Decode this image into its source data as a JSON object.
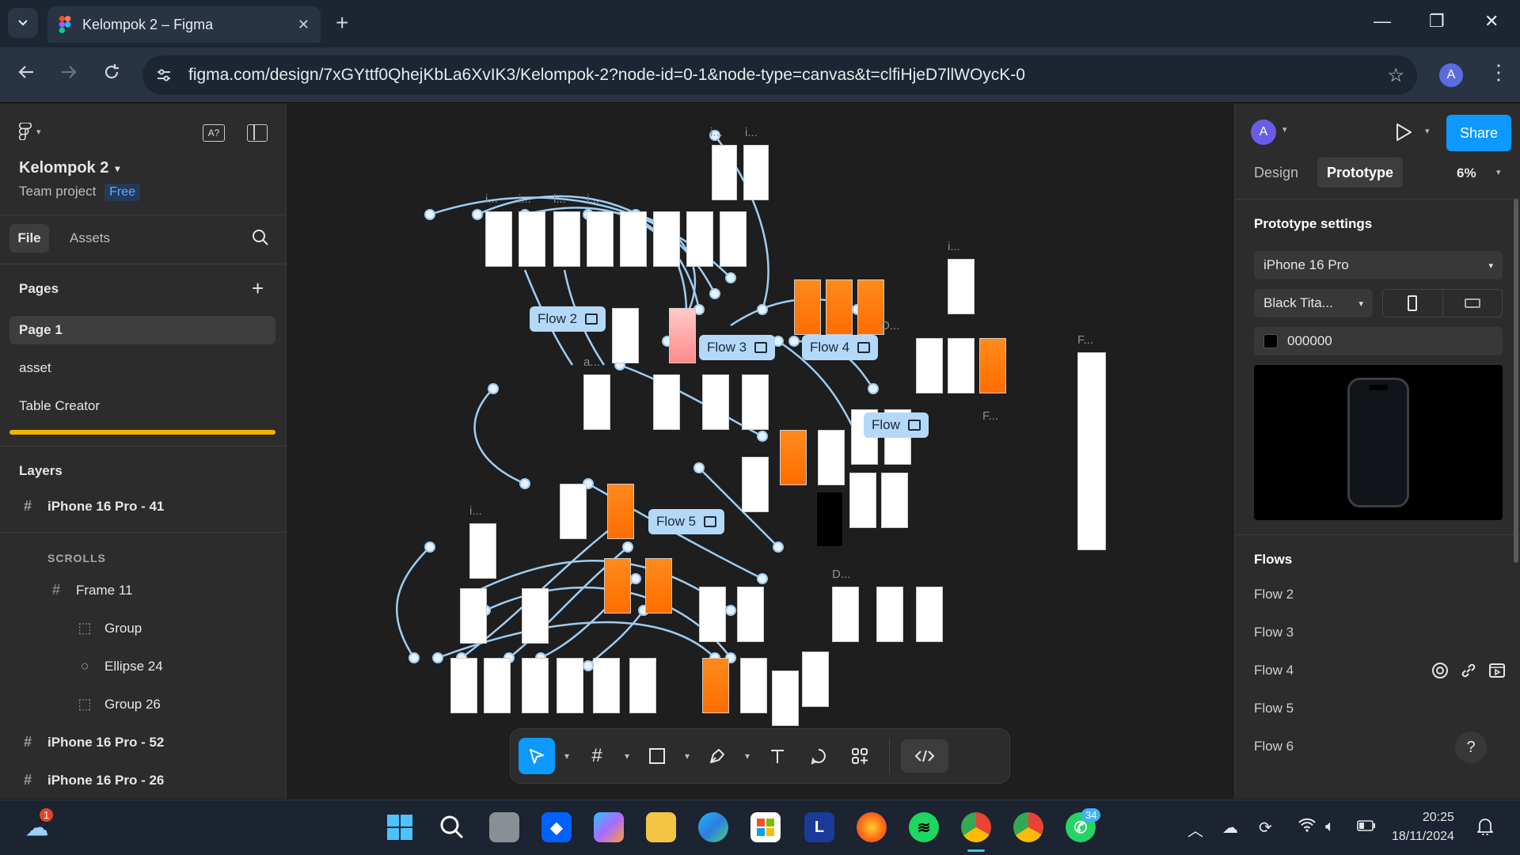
{
  "browser": {
    "tab_title": "Kelompok 2 – Figma",
    "tab_close": "✕",
    "new_tab": "+",
    "minimize": "—",
    "restore": "❐",
    "close": "✕",
    "url": "figma.com/design/7xGYttf0QhejKbLa6XvIK3/Kelompok-2?node-id=0-1&node-type=canvas&t=clfiHjeD7llWOycK-0",
    "profile_initial": "A"
  },
  "left_panel": {
    "file_name": "Kelompok 2",
    "project": "Team project",
    "plan_badge": "Free",
    "tabs": [
      "File",
      "Assets"
    ],
    "pages_heading": "Pages",
    "pages": [
      "Page 1",
      "asset",
      "Table Creator"
    ],
    "layers_heading": "Layers",
    "section_label": "SCROLLS",
    "layers": [
      {
        "name": "iPhone 16 Pro - 41",
        "type": "frame"
      },
      {
        "name": "Frame 11",
        "type": "frame"
      },
      {
        "name": "Group",
        "type": "group"
      },
      {
        "name": "Ellipse 24",
        "type": "ellipse"
      },
      {
        "name": "Group 26",
        "type": "group"
      },
      {
        "name": "iPhone 16 Pro - 52",
        "type": "frame"
      },
      {
        "name": "iPhone 16 Pro - 26",
        "type": "frame"
      }
    ]
  },
  "canvas": {
    "flow_tags": [
      "Flow 2",
      "Flow 3",
      "Flow 4",
      "Flow",
      "Flow 5"
    ],
    "frame_labels": [
      "i...",
      "i...",
      "i...",
      "i...",
      "i...",
      "i...",
      "i...",
      "i...",
      "a...",
      "F...",
      "D...",
      "F...",
      "D..."
    ]
  },
  "right_panel": {
    "avatar_initial": "A",
    "share_label": "Share",
    "tabs": [
      "Design",
      "Prototype"
    ],
    "zoom": "6%",
    "prototype_settings_heading": "Prototype settings",
    "device": "iPhone 16 Pro",
    "model": "Black Tita...",
    "bg_hex": "000000",
    "flows_heading": "Flows",
    "flows": [
      "Flow 2",
      "Flow 3",
      "Flow 4",
      "Flow 5",
      "Flow 6"
    ],
    "help": "?"
  },
  "taskbar": {
    "cloud_badge": "1",
    "whatsapp_badge": "34",
    "time": "20:25",
    "date": "18/11/2024"
  },
  "colors": {
    "figma_blue": "#0d99ff",
    "flow_tag": "#b4d8f8",
    "frame_orange": "#ff7a00"
  }
}
